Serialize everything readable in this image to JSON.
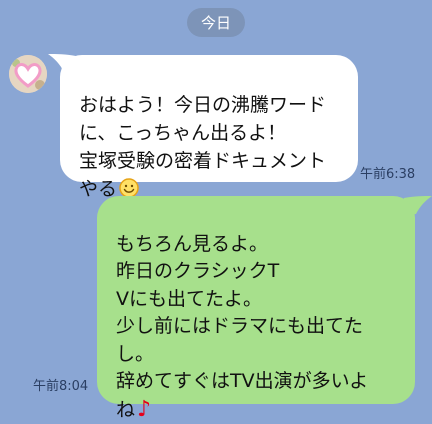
{
  "chat": {
    "date_label": "今日",
    "messages": [
      {
        "direction": "incoming",
        "text": "おはよう！今日の沸騰ワード\nに、こっちゃん出るよ！\n宝塚受験の密着ドキュメント\nやる",
        "emoji": "smile-emoji",
        "time": "午前6:38"
      },
      {
        "direction": "outgoing",
        "text": "もちろん見るよ。\n昨日のクラシックT\nVにも出てたよ。\n少し前にはドラマにも出てた\nし。\n辞めてすぐはTV出演が多いよ\nね",
        "emoji": "♪",
        "time": "午前8:04"
      }
    ]
  },
  "colors": {
    "background": "#8aa6d4",
    "incoming_bubble": "#ffffff",
    "outgoing_bubble": "#a7e08c",
    "date_pill": "#7d94b8",
    "note_color": "#e5001c"
  },
  "icons": {
    "avatar": "heart-avatar-icon"
  }
}
